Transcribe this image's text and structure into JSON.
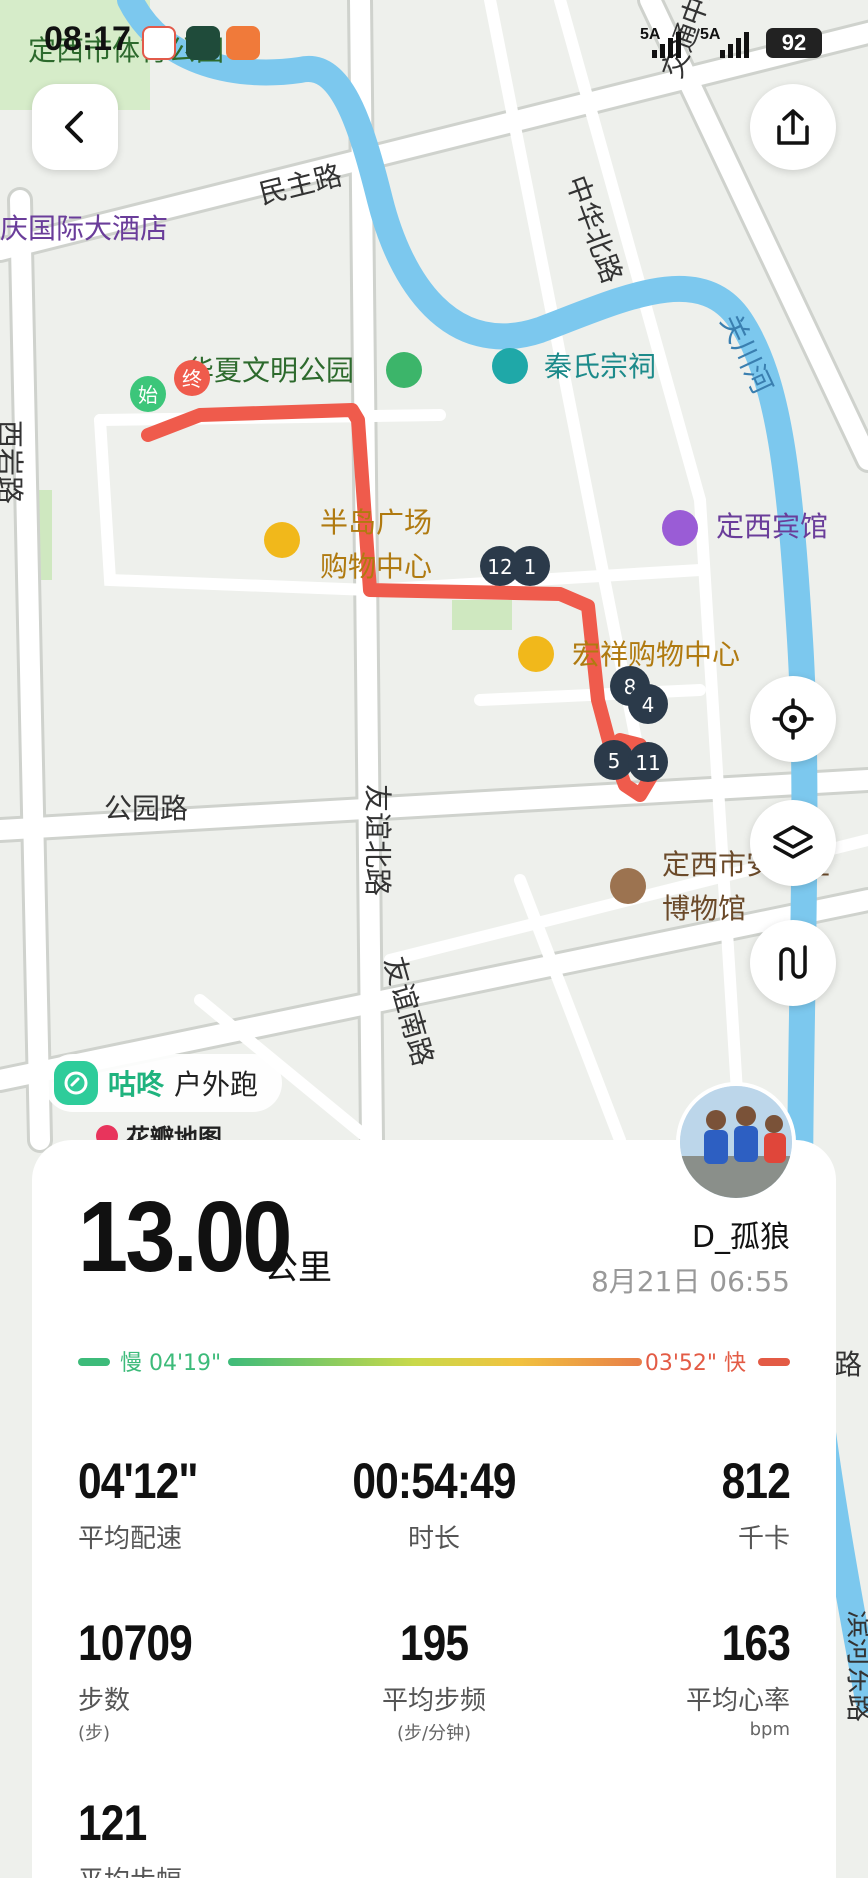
{
  "status_bar": {
    "time": "08:17",
    "signal_1": "5A",
    "signal_2": "5A",
    "battery": "92"
  },
  "map": {
    "labels": {
      "park_top": "定西市体育公园",
      "hotel": "庆国际大酒店",
      "minzhu_road": "民主路",
      "jiaotong_road": "交通中路",
      "zhonghua_road": "中华北路",
      "guanchuan_river": "关川河",
      "civilization_park": "华夏文明公园",
      "qin_temple": "秦氏宗祠",
      "xiyan_road": "西岩路",
      "peninsula_mall_1": "半岛广场",
      "peninsula_mall_2": "购物中心",
      "guesthouse": "定西宾馆",
      "hongxiang_mall": "宏祥购物中心",
      "park_road": "公园路",
      "youyi_north": "友谊北路",
      "youyi_south": "友谊南路",
      "museum_1": "定西市安定区",
      "museum_2": "博物馆",
      "binhe_road": "滨河东路",
      "road_fragment": "路"
    },
    "route_markers": {
      "start": "始",
      "end": "终",
      "km_markers": [
        "12",
        "1",
        "8",
        "4",
        "5",
        "11"
      ]
    },
    "colors": {
      "route": "#ef5b4c",
      "river": "#7cc8ee"
    }
  },
  "controls": {
    "back_icon": "chevron-left-icon",
    "share_icon": "share-icon",
    "locate_icon": "locate-icon",
    "layers_icon": "layers-icon",
    "route_icon": "route-icon"
  },
  "brand": {
    "name": "咕咚",
    "sub": "户外跑",
    "map_source": "花瓣地图"
  },
  "summary": {
    "distance": "13.00",
    "distance_unit": "公里",
    "username": "D_孤狼",
    "date": "8月21日 06:55"
  },
  "pace_range": {
    "slow_label": "慢 04'19\"",
    "fast_label": "03'52\" 快"
  },
  "stats": [
    {
      "value": "04'12\"",
      "label": "平均配速",
      "unit": ""
    },
    {
      "value": "00:54:49",
      "label": "时长",
      "unit": ""
    },
    {
      "value": "812",
      "label": "千卡",
      "unit": ""
    },
    {
      "value": "10709",
      "label": "步数",
      "unit": "(步)"
    },
    {
      "value": "195",
      "label": "平均步频",
      "unit": "(步/分钟)"
    },
    {
      "value": "163",
      "label": "平均心率",
      "unit": "bpm"
    },
    {
      "value": "121",
      "label": "平均步幅",
      "unit": ""
    }
  ]
}
